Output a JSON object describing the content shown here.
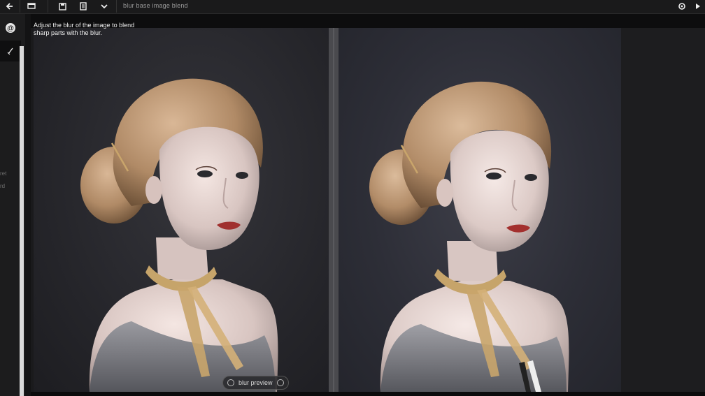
{
  "toolbar": {
    "title": "blur base image blend",
    "icons": [
      "back-arrow-icon",
      "layers-icon",
      "save-icon",
      "list-icon",
      "check-icon",
      "settings-icon",
      "forward-icon"
    ]
  },
  "sidebar": {
    "tools": [
      "help-icon",
      "pen-icon"
    ],
    "labels": [
      "ret",
      "rd"
    ]
  },
  "caption": {
    "text": "Adjust the blur of the image to blend\nsharp parts with the blur."
  },
  "status": {
    "label": "blur preview"
  },
  "colors": {
    "background": "#0d0d0e",
    "toolbar": "#1a1a1b",
    "panel_left": "#2a2a2f",
    "panel_right": "#30313a",
    "divider": "#4a4a4e"
  }
}
